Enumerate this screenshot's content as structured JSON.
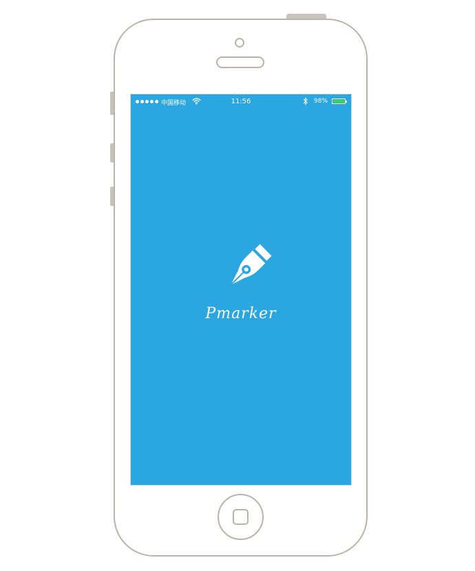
{
  "status_bar": {
    "carrier": "中国移动",
    "time": "11:56",
    "battery_percent": "98%",
    "battery_level": 0.98,
    "signal_dots": 5,
    "battery_color": "#3cd93c"
  },
  "splash": {
    "app_name": "Pmarker",
    "logo_icon": "fountain-pen-nib-icon",
    "background_color": "#2aa6e0"
  },
  "device": {
    "home_button_icon": "home-square-icon"
  }
}
